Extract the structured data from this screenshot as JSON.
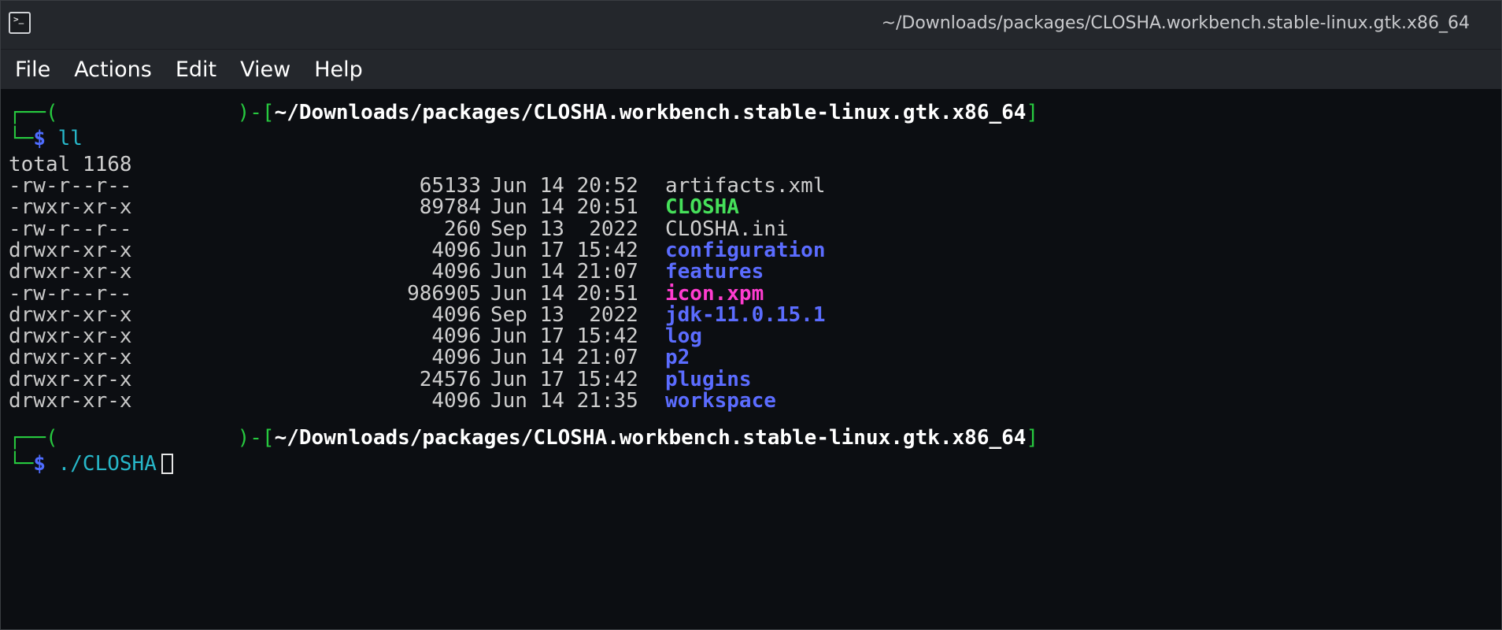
{
  "window": {
    "title": "~/Downloads/packages/CLOSHA.workbench.stable-linux.gtk.x86_64",
    "icon": "terminal-icon"
  },
  "menu": {
    "items": [
      "File",
      "Actions",
      "Edit",
      "View",
      "Help"
    ]
  },
  "prompt1": {
    "corner_top": "┌──(",
    "user_host": "",
    "close_paren": ")-[",
    "path": "~/Downloads/packages/CLOSHA.workbench.stable-linux.gtk.x86_64",
    "close_bracket": "]",
    "corner_bottom": "└─",
    "dollar": "$",
    "command": "ll"
  },
  "total": "total 1168",
  "listing": [
    {
      "perm": "-rw-r--r--",
      "size": "65133",
      "date": "Jun 14 20:52",
      "name": "artifacts.xml",
      "kind": "plain"
    },
    {
      "perm": "-rwxr-xr-x",
      "size": "89784",
      "date": "Jun 14 20:51",
      "name": "CLOSHA",
      "kind": "exe"
    },
    {
      "perm": "-rw-r--r--",
      "size": "260",
      "date": "Sep 13  2022",
      "name": "CLOSHA.ini",
      "kind": "plain"
    },
    {
      "perm": "drwxr-xr-x",
      "size": "4096",
      "date": "Jun 17 15:42",
      "name": "configuration",
      "kind": "dir"
    },
    {
      "perm": "drwxr-xr-x",
      "size": "4096",
      "date": "Jun 14 21:07",
      "name": "features",
      "kind": "dir"
    },
    {
      "perm": "-rw-r--r--",
      "size": "986905",
      "date": "Jun 14 20:51",
      "name": "icon.xpm",
      "kind": "img"
    },
    {
      "perm": "drwxr-xr-x",
      "size": "4096",
      "date": "Sep 13  2022",
      "name": "jdk-11.0.15.1",
      "kind": "dir"
    },
    {
      "perm": "drwxr-xr-x",
      "size": "4096",
      "date": "Jun 17 15:42",
      "name": "log",
      "kind": "dir"
    },
    {
      "perm": "drwxr-xr-x",
      "size": "4096",
      "date": "Jun 14 21:07",
      "name": "p2",
      "kind": "dir"
    },
    {
      "perm": "drwxr-xr-x",
      "size": "24576",
      "date": "Jun 17 15:42",
      "name": "plugins",
      "kind": "dir"
    },
    {
      "perm": "drwxr-xr-x",
      "size": "4096",
      "date": "Jun 14 21:35",
      "name": "workspace",
      "kind": "dir"
    }
  ],
  "prompt2": {
    "corner_top": "┌──(",
    "user_host": "",
    "close_paren": ")-[",
    "path": "~/Downloads/packages/CLOSHA.workbench.stable-linux.gtk.x86_64",
    "close_bracket": "]",
    "corner_bottom": "└─",
    "dollar": "$",
    "command": "./CLOSHA"
  },
  "colors": {
    "background": "#0c0e12",
    "titlebar": "#24272c",
    "prompt_green": "#27c93f",
    "directory_blue": "#5b6cff",
    "executable_green": "#46e05a",
    "image_magenta": "#ff3ccf",
    "command_cyan": "#27b7c9"
  }
}
